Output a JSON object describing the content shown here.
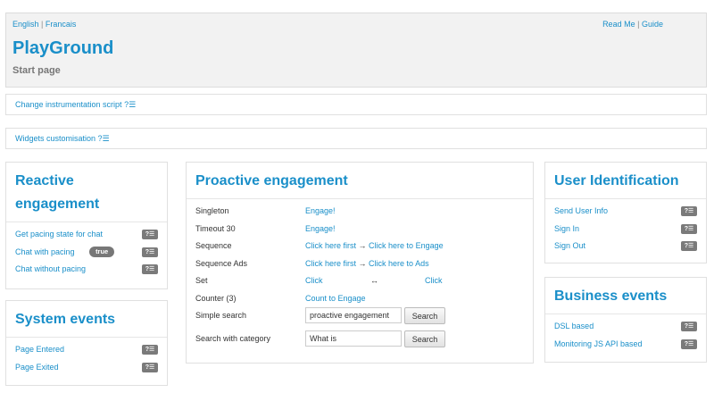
{
  "header": {
    "lang_english": "English",
    "lang_sep": "|",
    "lang_french": "Francais",
    "readme": "Read Me",
    "links_sep": "|",
    "guide": "Guide",
    "title": "PlayGround",
    "subtitle": "Start page"
  },
  "bars": {
    "instrumentation": "Change instrumentation script ?☰",
    "widgets": "Widgets customisation ?☰"
  },
  "reactive": {
    "title": "Reactive engagement",
    "items": [
      {
        "label": "Get pacing state for chat",
        "badge": "?☰"
      },
      {
        "label": "Chat with pacing",
        "pill": "true",
        "badge": "?☰"
      },
      {
        "label": "Chat without pacing",
        "badge": "?☰"
      }
    ]
  },
  "system_events": {
    "title": "System events",
    "items": [
      {
        "label": "Page Entered",
        "badge": "?☰"
      },
      {
        "label": "Page Exited",
        "badge": "?☰"
      }
    ]
  },
  "proactive": {
    "title": "Proactive engagement",
    "singleton_label": "Singleton",
    "singleton_link": "Engage!",
    "timeout_label": "Timeout 30",
    "timeout_link": "Engage!",
    "sequence_label": "Sequence",
    "sequence_first": "Click here first",
    "sequence_arrow": "→",
    "sequence_second": "Click here to Engage",
    "sequence_ads_label": "Sequence Ads",
    "sequence_ads_first": "Click here first",
    "sequence_ads_arrow": "→",
    "sequence_ads_second": "Click here to Ads",
    "set_label": "Set",
    "set_click1": "Click",
    "set_arrow": "↔",
    "set_click2": "Click",
    "counter_label": "Counter (3)",
    "counter_link": "Count to Engage",
    "simple_search_label": "Simple search",
    "simple_search_value": "proactive engagement",
    "simple_search_button": "Search",
    "category_search_label": "Search with category",
    "category_search_value": "What is",
    "category_search_button": "Search"
  },
  "user_identification": {
    "title": "User Identification",
    "items": [
      {
        "label": "Send User Info",
        "badge": "?☰"
      },
      {
        "label": "Sign In",
        "badge": "?☰"
      },
      {
        "label": "Sign Out",
        "badge": "?☰"
      }
    ]
  },
  "business_events": {
    "title": "Business events",
    "items": [
      {
        "label": "DSL based",
        "badge": "?☰"
      },
      {
        "label": "Monitoring JS API based",
        "badge": "?☰"
      }
    ]
  }
}
